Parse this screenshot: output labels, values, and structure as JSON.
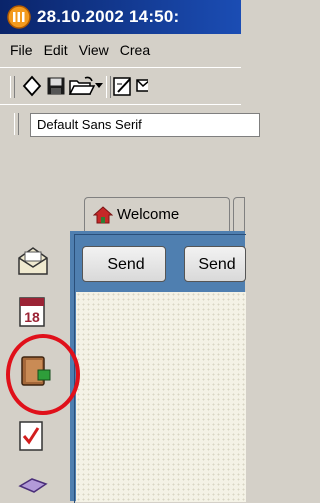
{
  "window": {
    "title": "28.10.2002 14:50:"
  },
  "menu": {
    "items": [
      "File",
      "Edit",
      "View",
      "Crea"
    ]
  },
  "toolbar": {
    "icons": [
      "diamond-icon",
      "save-icon",
      "open-folder-icon",
      "dropdown-arrow-icon",
      "edit-note-icon",
      "mail-icon"
    ]
  },
  "format": {
    "font_name": "Default Sans Serif"
  },
  "tabs": {
    "welcome_label": "Welcome"
  },
  "compose": {
    "send_label": "Send",
    "send2_label": "Send"
  },
  "sidebar": {
    "items": [
      "mail-icon",
      "calendar-icon",
      "address-book-icon",
      "tasks-icon",
      "notes-icon"
    ]
  },
  "colors": {
    "title_bar": "#0a246a",
    "panel": "#4f7fb0",
    "highlight": "#e0101a"
  }
}
